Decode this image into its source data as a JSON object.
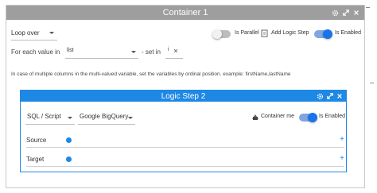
{
  "container": {
    "title": "Container 1",
    "loop_select": "Loop over",
    "is_parallel_label": "Is Parallel",
    "add_logic_step_label": "Add Logic Step",
    "is_enabled_label": "Is Enabled",
    "for_each_label": "For each value in",
    "list_value": "list",
    "set_in_label": "- set in",
    "set_in_value": "i",
    "help_text": "In case of multiple columns in the multi-valued variable, set the variables by ordinal position. example: firstName,lastName"
  },
  "logic_step": {
    "title": "Logic Step 2",
    "type_select": "SQL / Script",
    "connection_select": "Google BigQuery",
    "container_me_label": "Container me",
    "is_enabled_label": "Is Enabled",
    "source_label": "Source",
    "target_label": "Target"
  },
  "colors": {
    "container_header": "#9e9e9e",
    "logic_header": "#1e88e5",
    "toggle_on": "#1a73e8"
  }
}
